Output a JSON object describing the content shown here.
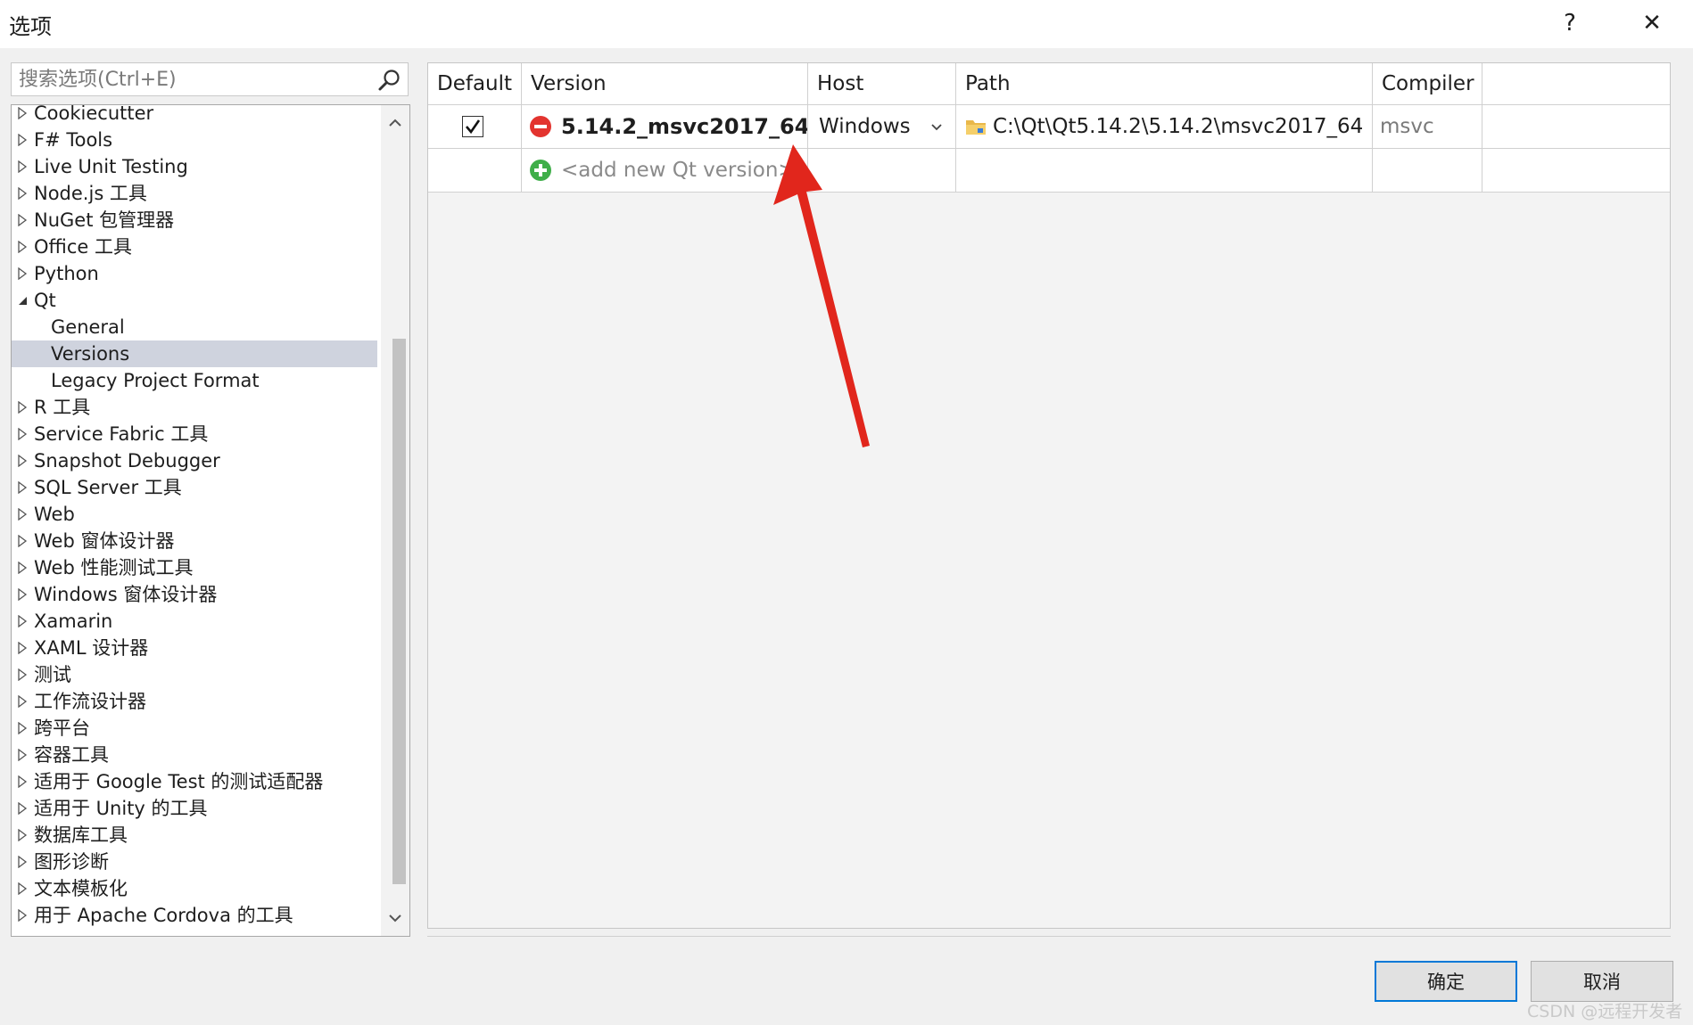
{
  "window": {
    "title": "选项",
    "help_label": "?",
    "close_label": "✕"
  },
  "search": {
    "placeholder": "搜索选项(Ctrl+E)"
  },
  "tree": {
    "items": [
      {
        "label": "Cookiecutter",
        "level": 0,
        "arrow": "collapsed"
      },
      {
        "label": "F# Tools",
        "level": 0,
        "arrow": "collapsed"
      },
      {
        "label": "Live Unit Testing",
        "level": 0,
        "arrow": "collapsed"
      },
      {
        "label": "Node.js 工具",
        "level": 0,
        "arrow": "collapsed"
      },
      {
        "label": "NuGet 包管理器",
        "level": 0,
        "arrow": "collapsed"
      },
      {
        "label": "Office 工具",
        "level": 0,
        "arrow": "collapsed"
      },
      {
        "label": "Python",
        "level": 0,
        "arrow": "collapsed"
      },
      {
        "label": "Qt",
        "level": 0,
        "arrow": "expanded"
      },
      {
        "label": "General",
        "level": 1,
        "arrow": "none"
      },
      {
        "label": "Versions",
        "level": 1,
        "arrow": "none",
        "selected": true
      },
      {
        "label": "Legacy Project Format",
        "level": 1,
        "arrow": "none"
      },
      {
        "label": "R 工具",
        "level": 0,
        "arrow": "collapsed"
      },
      {
        "label": "Service Fabric 工具",
        "level": 0,
        "arrow": "collapsed"
      },
      {
        "label": "Snapshot Debugger",
        "level": 0,
        "arrow": "collapsed"
      },
      {
        "label": "SQL Server 工具",
        "level": 0,
        "arrow": "collapsed"
      },
      {
        "label": "Web",
        "level": 0,
        "arrow": "collapsed"
      },
      {
        "label": "Web 窗体设计器",
        "level": 0,
        "arrow": "collapsed"
      },
      {
        "label": "Web 性能测试工具",
        "level": 0,
        "arrow": "collapsed"
      },
      {
        "label": "Windows 窗体设计器",
        "level": 0,
        "arrow": "collapsed"
      },
      {
        "label": "Xamarin",
        "level": 0,
        "arrow": "collapsed"
      },
      {
        "label": "XAML 设计器",
        "level": 0,
        "arrow": "collapsed"
      },
      {
        "label": "测试",
        "level": 0,
        "arrow": "collapsed"
      },
      {
        "label": "工作流设计器",
        "level": 0,
        "arrow": "collapsed"
      },
      {
        "label": "跨平台",
        "level": 0,
        "arrow": "collapsed"
      },
      {
        "label": "容器工具",
        "level": 0,
        "arrow": "collapsed"
      },
      {
        "label": "适用于 Google Test 的测试适配器",
        "level": 0,
        "arrow": "collapsed"
      },
      {
        "label": "适用于 Unity 的工具",
        "level": 0,
        "arrow": "collapsed"
      },
      {
        "label": "数据库工具",
        "level": 0,
        "arrow": "collapsed"
      },
      {
        "label": "图形诊断",
        "level": 0,
        "arrow": "collapsed"
      },
      {
        "label": "文本模板化",
        "level": 0,
        "arrow": "collapsed"
      },
      {
        "label": "用于 Apache Cordova 的工具",
        "level": 0,
        "arrow": "collapsed"
      }
    ]
  },
  "grid": {
    "columns": [
      "Default",
      "Version",
      "Host",
      "Path",
      "Compiler"
    ],
    "rows": [
      {
        "default_checked": true,
        "version": "5.14.2_msvc2017_64",
        "host": "Windows",
        "path": "C:\\Qt\\Qt5.14.2\\5.14.2\\msvc2017_64",
        "compiler": "msvc"
      }
    ],
    "add_row_label": "<add new Qt version>"
  },
  "buttons": {
    "ok": "确定",
    "cancel": "取消"
  },
  "watermark": "CSDN @远程开发者",
  "colors": {
    "selection": "#cfd3de",
    "accent": "#0078d7",
    "remove_icon": "#e3342f",
    "add_icon": "#3fae49",
    "annotation_arrow": "#e1261c"
  }
}
